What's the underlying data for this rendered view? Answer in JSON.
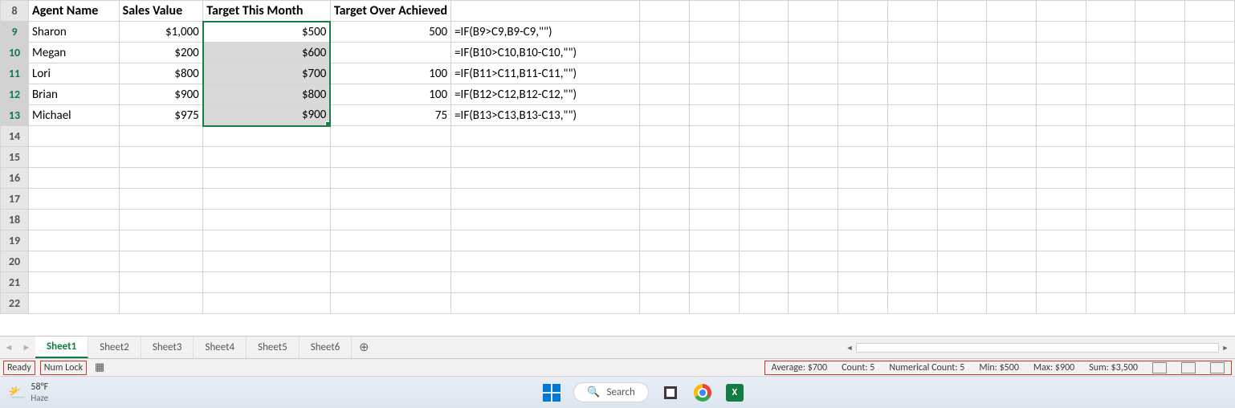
{
  "header_row_num": "8",
  "headers": {
    "A": "Agent Name",
    "B": "Sales Value",
    "C": "Target This Month",
    "D": "Target Over Achieved"
  },
  "rows": [
    {
      "n": "9",
      "A": "Sharon",
      "B": "$1,000",
      "C": "$500",
      "D": "500",
      "E": "=IF(B9>C9,B9-C9,\"\")"
    },
    {
      "n": "10",
      "A": "Megan",
      "B": "$200",
      "C": "$600",
      "D": "",
      "E": "=IF(B10>C10,B10-C10,\"\")"
    },
    {
      "n": "11",
      "A": "Lori",
      "B": "$800",
      "C": "$700",
      "D": "100",
      "E": "=IF(B11>C11,B11-C11,\"\")"
    },
    {
      "n": "12",
      "A": "Brian",
      "B": "$900",
      "C": "$800",
      "D": "100",
      "E": "=IF(B12>C12,B12-C12,\"\")"
    },
    {
      "n": "13",
      "A": "Michael",
      "B": "$975",
      "C": "$900",
      "D": "75",
      "E": "=IF(B13>C13,B13-C13,\"\")"
    }
  ],
  "empty_rows": [
    "14",
    "15",
    "16",
    "17",
    "18",
    "19",
    "20",
    "21",
    "22"
  ],
  "tabs": [
    "Sheet1",
    "Sheet2",
    "Sheet3",
    "Sheet4",
    "Sheet5",
    "Sheet6"
  ],
  "active_tab": "Sheet1",
  "status": {
    "ready": "Ready",
    "numlock": "Num Lock",
    "avg": "Average: $700",
    "count": "Count: 5",
    "numcount": "Numerical Count: 5",
    "min": "Min: $500",
    "max": "Max: $900",
    "sum": "Sum: $3,500"
  },
  "taskbar": {
    "temp": "58°F",
    "cond": "Haze",
    "search": "Search"
  }
}
